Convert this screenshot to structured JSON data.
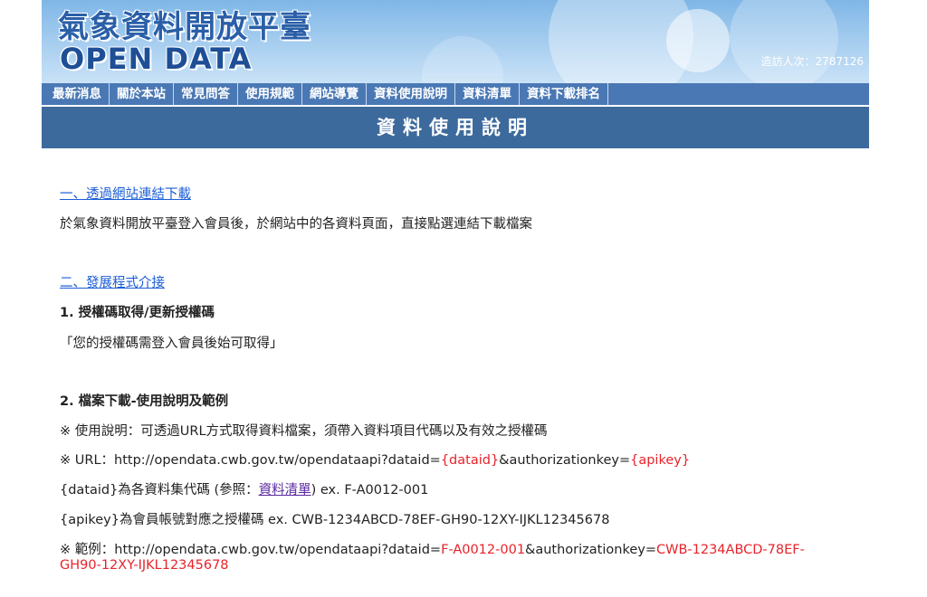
{
  "header": {
    "title_cn": "氣象資料開放平臺",
    "title_en": "OPEN DATA",
    "visitor_label": "造訪人次：2787126"
  },
  "nav": {
    "items": [
      "最新消息",
      "關於本站",
      "常見問答",
      "使用規範",
      "網站導覽",
      "資料使用說明",
      "資料清單",
      "資料下載排名"
    ]
  },
  "page_title": "資料使用說明",
  "content": {
    "section1_link": "一、透過網站連結下載",
    "section1_text": "於氣象資料開放平臺登入會員後，於網站中的各資料頁面，直接點選連結下載檔案",
    "section2_link": "二、發展程式介接",
    "item1_heading": "1. 授權碼取得/更新授權碼",
    "item1_text": "「您的授權碼需登入會員後始可取得」",
    "item2_heading": "2. 檔案下載-使用說明及範例",
    "usage_text": "※ 使用說明：可透過URL方式取得資料檔案，須帶入資料項目代碼以及有效之授權碼",
    "url_prefix": "※ URL：http://opendata.cwb.gov.tw/opendataapi?dataid=",
    "url_dataid": "{dataid}",
    "url_mid": "&authorizationkey=",
    "url_apikey": "{apikey}",
    "dataid_desc_prefix": "{dataid}為各資料集代碼 (參照：",
    "dataid_desc_link": "資料清單",
    "dataid_desc_suffix": ") ex. F-A0012-001",
    "apikey_desc": "{apikey}為會員帳號對應之授權碼 ex. CWB-1234ABCD-78EF-GH90-12XY-IJKL12345678",
    "example_prefix": "※ 範例：http://opendata.cwb.gov.tw/opendataapi?dataid=",
    "example_dataid": "F-A0012-001",
    "example_mid": "&authorizationkey=",
    "example_key_line1": "CWB-1234ABCD-78EF-",
    "example_key_line2": "GH90-12XY-IJKL12345678"
  },
  "colors": {
    "nav_bg": "#4a78b4",
    "titlebar_bg": "#3d6a9c",
    "link": "#1a5dd6",
    "highlight": "#e8232a"
  }
}
